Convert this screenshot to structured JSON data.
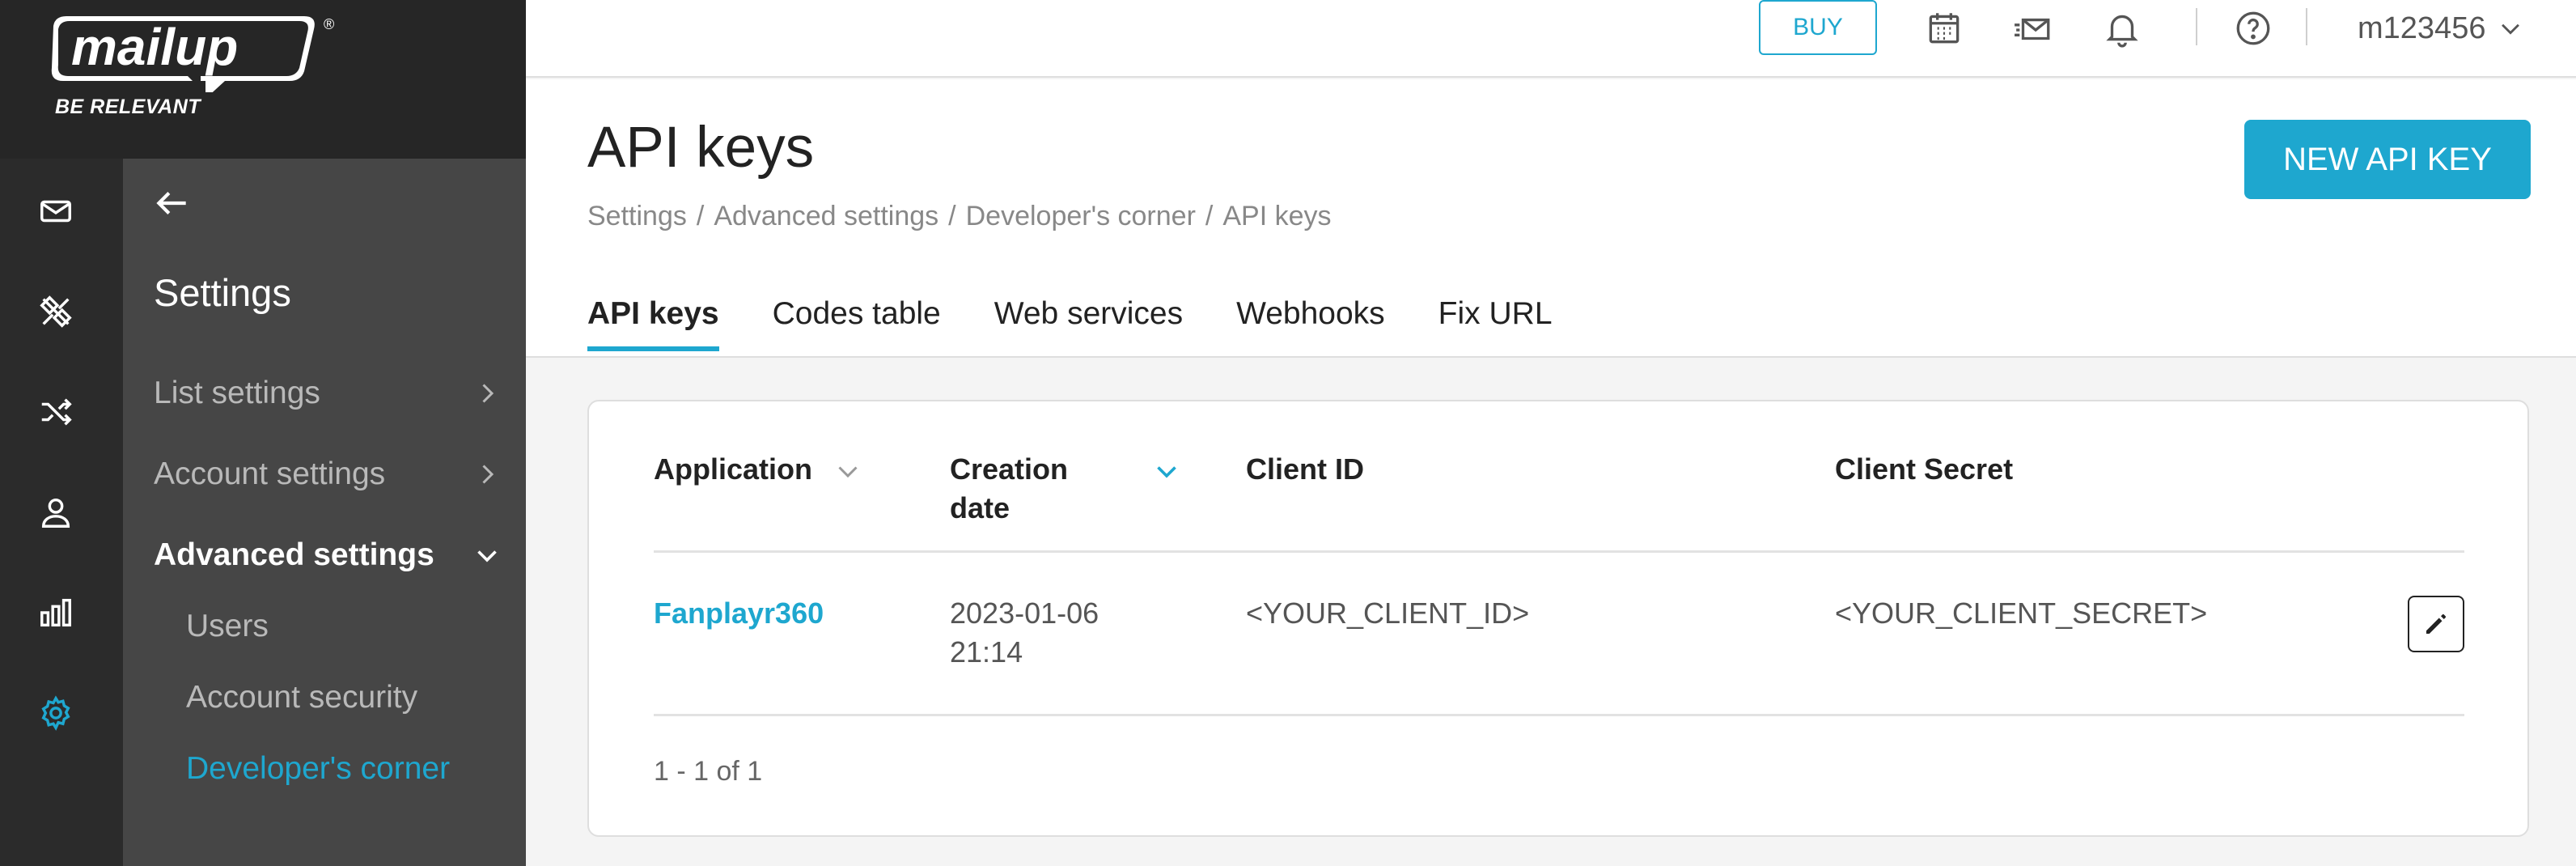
{
  "brand": {
    "logo": "mailup",
    "slogan": "BE RELEVANT",
    "registered": "®",
    "accent_color": "#1ea7cf"
  },
  "rail": {
    "icons": [
      "envelope-icon",
      "design-tools-icon",
      "shuffle-icon",
      "person-icon",
      "bar-chart-icon",
      "gear-icon"
    ],
    "active_icon": "gear-icon"
  },
  "subnav": {
    "title": "Settings",
    "items": [
      {
        "label": "List settings"
      },
      {
        "label": "Account settings"
      },
      {
        "label": "Advanced settings"
      }
    ],
    "sub_items": [
      {
        "label": "Users"
      },
      {
        "label": "Account security"
      },
      {
        "label": "Developer's corner"
      }
    ]
  },
  "topbar": {
    "buy_label": "BUY",
    "username": "m123456"
  },
  "page": {
    "title": "API keys",
    "breadcrumb": [
      "Settings",
      "Advanced settings",
      "Developer's corner",
      "API keys"
    ],
    "breadcrumb_sep": "/",
    "new_button_label": "NEW API KEY",
    "tabs": [
      {
        "label": "API keys"
      },
      {
        "label": "Codes table"
      },
      {
        "label": "Web services"
      },
      {
        "label": "Webhooks"
      },
      {
        "label": "Fix URL"
      }
    ],
    "active_tab": "API keys"
  },
  "table": {
    "columns": {
      "application": "Application",
      "creation_date_1": "Creation",
      "creation_date_2": "date",
      "client_id": "Client ID",
      "client_secret": "Client Secret"
    },
    "rows": [
      {
        "application": "Fanplayr360",
        "date": "2023-01-06",
        "time": "21:14",
        "client_id": "<YOUR_CLIENT_ID>",
        "client_secret": "<YOUR_CLIENT_SECRET>"
      }
    ],
    "pagination": "1 - 1 of 1"
  }
}
